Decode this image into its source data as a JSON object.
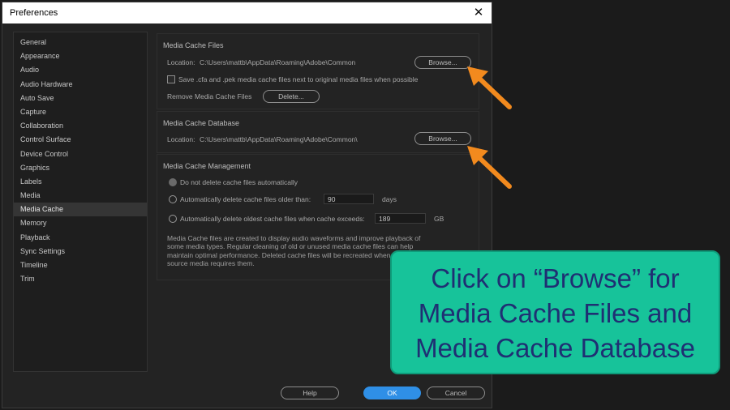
{
  "dialog": {
    "title": "Preferences",
    "close_glyph": "✕"
  },
  "sidebar": {
    "items": [
      {
        "label": "General"
      },
      {
        "label": "Appearance"
      },
      {
        "label": "Audio"
      },
      {
        "label": "Audio Hardware"
      },
      {
        "label": "Auto Save"
      },
      {
        "label": "Capture"
      },
      {
        "label": "Collaboration"
      },
      {
        "label": "Control Surface"
      },
      {
        "label": "Device Control"
      },
      {
        "label": "Graphics"
      },
      {
        "label": "Labels"
      },
      {
        "label": "Media"
      },
      {
        "label": "Media Cache"
      },
      {
        "label": "Memory"
      },
      {
        "label": "Playback"
      },
      {
        "label": "Sync Settings"
      },
      {
        "label": "Timeline"
      },
      {
        "label": "Trim"
      }
    ],
    "selected": "Media Cache"
  },
  "cache_files": {
    "title": "Media Cache Files",
    "location_label": "Location:",
    "location_path": "C:\\Users\\mattb\\AppData\\Roaming\\Adobe\\Common",
    "browse_label": "Browse...",
    "save_checkbox_label": "Save .cfa and .pek media cache files next to original media files when possible",
    "remove_label": "Remove Media Cache Files",
    "delete_label": "Delete..."
  },
  "cache_database": {
    "title": "Media Cache Database",
    "location_label": "Location:",
    "location_path": "C:\\Users\\mattb\\AppData\\Roaming\\Adobe\\Common\\",
    "browse_label": "Browse..."
  },
  "cache_management": {
    "title": "Media Cache Management",
    "option_none": "Do not delete cache files automatically",
    "option_older": "Automatically delete cache files older than:",
    "older_value": "90",
    "older_unit": "days",
    "option_exceeds": "Automatically delete oldest cache files when cache exceeds:",
    "exceeds_value": "189",
    "exceeds_unit": "GB",
    "description": "Media Cache files are created to display audio waveforms and improve playback of\nsome media types.  Regular cleaning of old or unused media cache files can help\nmaintain optimal performance. Deleted cache files will be recreated when\nsource media requires them."
  },
  "footer": {
    "help_label": "Help",
    "ok_label": "OK",
    "cancel_label": "Cancel"
  },
  "callout": {
    "line1": "Click on “Browse” for",
    "line2": "Media Cache Files and",
    "line3": "Media Cache Database",
    "background": "#17c39a",
    "text_color": "#1f2f73"
  },
  "arrow_color": "#f28a1e",
  "accent_color": "#2f8fe6"
}
